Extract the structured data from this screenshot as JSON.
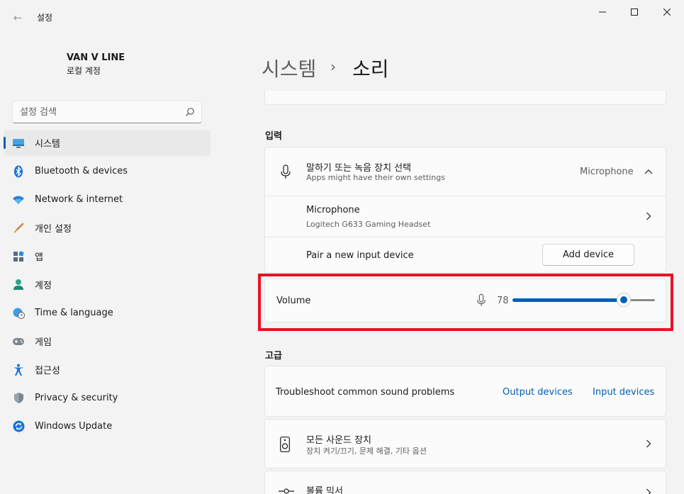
{
  "window": {
    "back_icon": "back-arrow-icon",
    "title": "설정",
    "min_icon": "minimize-icon",
    "max_icon": "maximize-icon",
    "close_icon": "close-icon"
  },
  "account": {
    "name": "VAN V LINE",
    "type": "로컬 계정"
  },
  "search": {
    "placeholder": "설정 검색",
    "value": "",
    "icon": "search-icon"
  },
  "sidebar": {
    "accent_color": "#005fb8",
    "items": [
      {
        "label": "시스템",
        "icon": "system-display-icon",
        "active": true
      },
      {
        "label": "Bluetooth & devices",
        "icon": "bluetooth-icon"
      },
      {
        "label": "Network & internet",
        "icon": "wifi-icon"
      },
      {
        "label": "개인 설정",
        "icon": "brush-icon"
      },
      {
        "label": "앱",
        "icon": "apps-icon"
      },
      {
        "label": "계정",
        "icon": "account-icon"
      },
      {
        "label": "Time & language",
        "icon": "globe-clock-icon"
      },
      {
        "label": "게임",
        "icon": "gamepad-icon"
      },
      {
        "label": "접근성",
        "icon": "accessibility-icon"
      },
      {
        "label": "Privacy & security",
        "icon": "shield-icon"
      },
      {
        "label": "Windows Update",
        "icon": "update-icon"
      }
    ]
  },
  "breadcrumb": {
    "parent": "시스템",
    "separator": "›",
    "current": "소리"
  },
  "input_section": {
    "heading": "입력",
    "choose_device": {
      "title": "말하기 또는 녹음 장치 선택",
      "subtitle": "Apps might have their own settings",
      "selected": "Microphone",
      "icon": "microphone-icon",
      "expanded": true
    },
    "microphone": {
      "title": "Microphone",
      "subtitle": "Logitech G633 Gaming Headset"
    },
    "pair": {
      "title": "Pair a new input device",
      "button": "Add device"
    },
    "volume": {
      "label": "Volume",
      "icon": "microphone-icon",
      "value": "78",
      "level": 0.78
    }
  },
  "advanced_section": {
    "heading": "고급",
    "troubleshoot": {
      "title": "Troubleshoot common sound problems",
      "link_output": "Output devices",
      "link_input": "Input devices"
    },
    "all_devices": {
      "title": "모든 사운드 장치",
      "subtitle": "장치 켜기/끄기, 문제 해결, 기타 옵션",
      "icon": "speaker-icon"
    },
    "mixer": {
      "title": "볼륨 믹서",
      "icon": "mixer-icon"
    }
  },
  "highlight_color": "#e81123"
}
